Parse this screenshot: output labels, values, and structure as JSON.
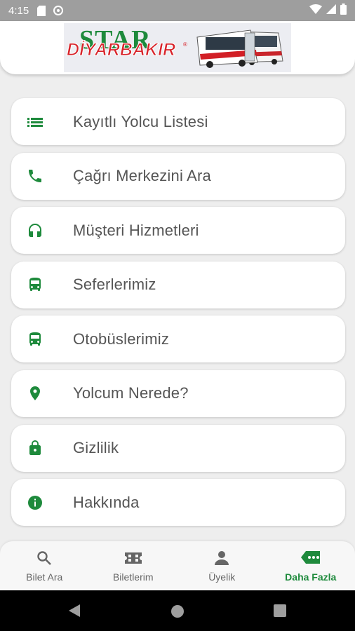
{
  "status_bar": {
    "time": "4:15",
    "icons": [
      "sd-card-icon",
      "sync-icon",
      "wifi-icon",
      "signal-icon",
      "battery-icon"
    ]
  },
  "header": {
    "logo_star": "STAR",
    "logo_city": "DİYARBAKIR",
    "logo_reg": "®"
  },
  "colors": {
    "accent": "#1e8a3c",
    "text": "#555555",
    "background": "#eeeeee"
  },
  "menu": {
    "items": [
      {
        "label": "Kayıtlı Yolcu Listesi",
        "icon": "list-icon"
      },
      {
        "label": "Çağrı Merkezini Ara",
        "icon": "phone-icon"
      },
      {
        "label": "Müşteri Hizmetleri",
        "icon": "headset-icon"
      },
      {
        "label": "Seferlerimiz",
        "icon": "bus-icon"
      },
      {
        "label": "Otobüslerimiz",
        "icon": "bus-icon"
      },
      {
        "label": "Yolcum Nerede?",
        "icon": "location-pin-icon"
      },
      {
        "label": "Gizlilik",
        "icon": "lock-icon"
      },
      {
        "label": "Hakkında",
        "icon": "info-icon"
      }
    ]
  },
  "bottom_nav": {
    "items": [
      {
        "label": "Bilet Ara",
        "icon": "search-icon",
        "active": false
      },
      {
        "label": "Biletlerim",
        "icon": "ticket-icon",
        "active": false
      },
      {
        "label": "Üyelik",
        "icon": "person-icon",
        "active": false
      },
      {
        "label": "Daha Fazla",
        "icon": "more-chat-icon",
        "active": true
      }
    ]
  }
}
